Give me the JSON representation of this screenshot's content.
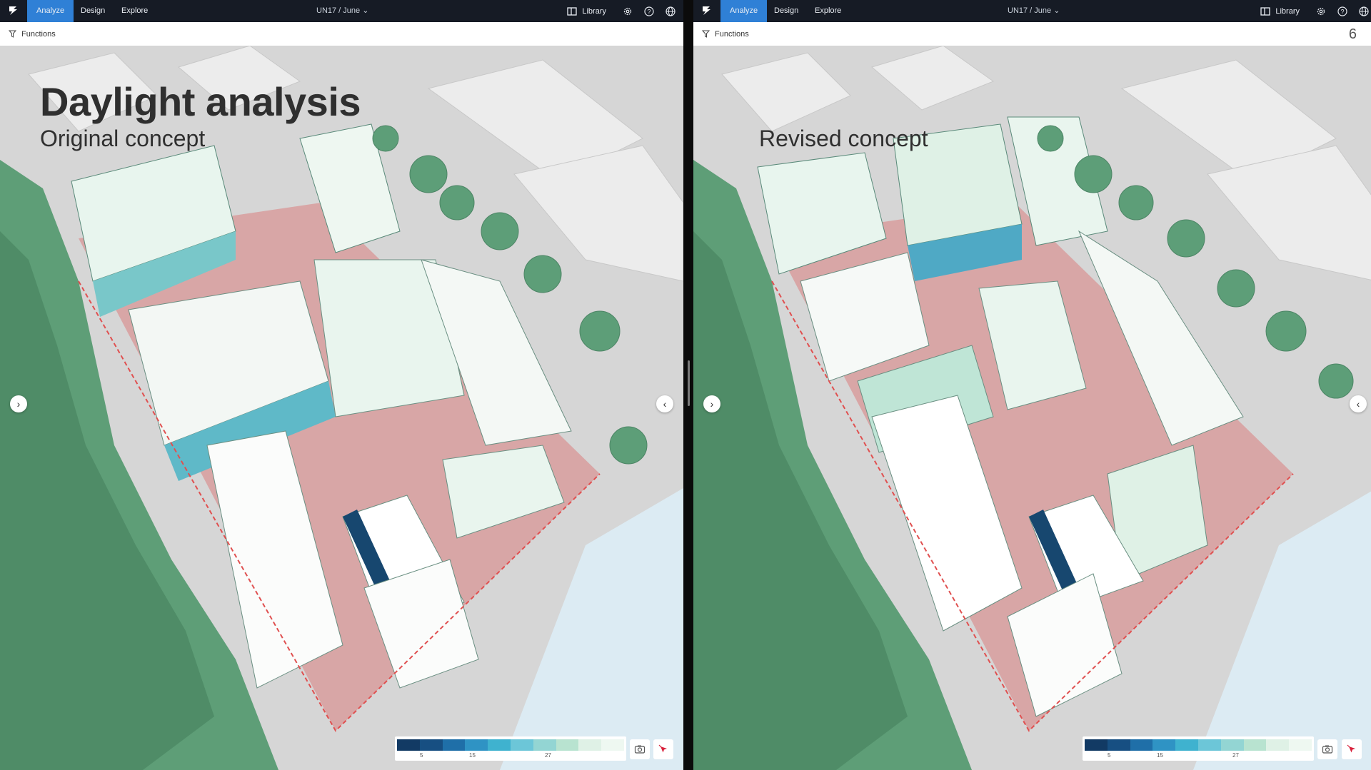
{
  "panes": [
    {
      "nav": {
        "tabs": [
          {
            "label": "Analyze",
            "active": true
          },
          {
            "label": "Design",
            "active": false
          },
          {
            "label": "Explore",
            "active": false
          }
        ],
        "project": "UN17 / June",
        "library_label": "Library"
      },
      "functions_label": "Functions",
      "title": "Daylight analysis",
      "subtitle": "Original concept",
      "page_number": "",
      "legend": {
        "ticks": [
          "5",
          "15",
          "27"
        ]
      }
    },
    {
      "nav": {
        "tabs": [
          {
            "label": "Analyze",
            "active": true
          },
          {
            "label": "Design",
            "active": false
          },
          {
            "label": "Explore",
            "active": false
          }
        ],
        "project": "UN17 / June",
        "library_label": "Library"
      },
      "functions_label": "Functions",
      "title": "",
      "subtitle": "Revised concept",
      "page_number": "6",
      "legend": {
        "ticks": [
          "5",
          "15",
          "27"
        ]
      }
    }
  ],
  "colors": {
    "nav_bg": "#161b25",
    "accent": "#2f80d6",
    "legend_scale": [
      "#123a64",
      "#174f82",
      "#1f6fa8",
      "#2f93c4",
      "#3fb2cf",
      "#6cc6d8",
      "#93d5d3",
      "#b8e3d0",
      "#dff1e6",
      "#eef8f1"
    ]
  },
  "icons": [
    "logo-icon",
    "library-icon",
    "settings-icon",
    "help-icon",
    "globe-icon",
    "filter-icon",
    "chevron-down-icon",
    "chevron-right-icon",
    "chevron-left-icon",
    "camera-icon",
    "pointer-icon"
  ]
}
